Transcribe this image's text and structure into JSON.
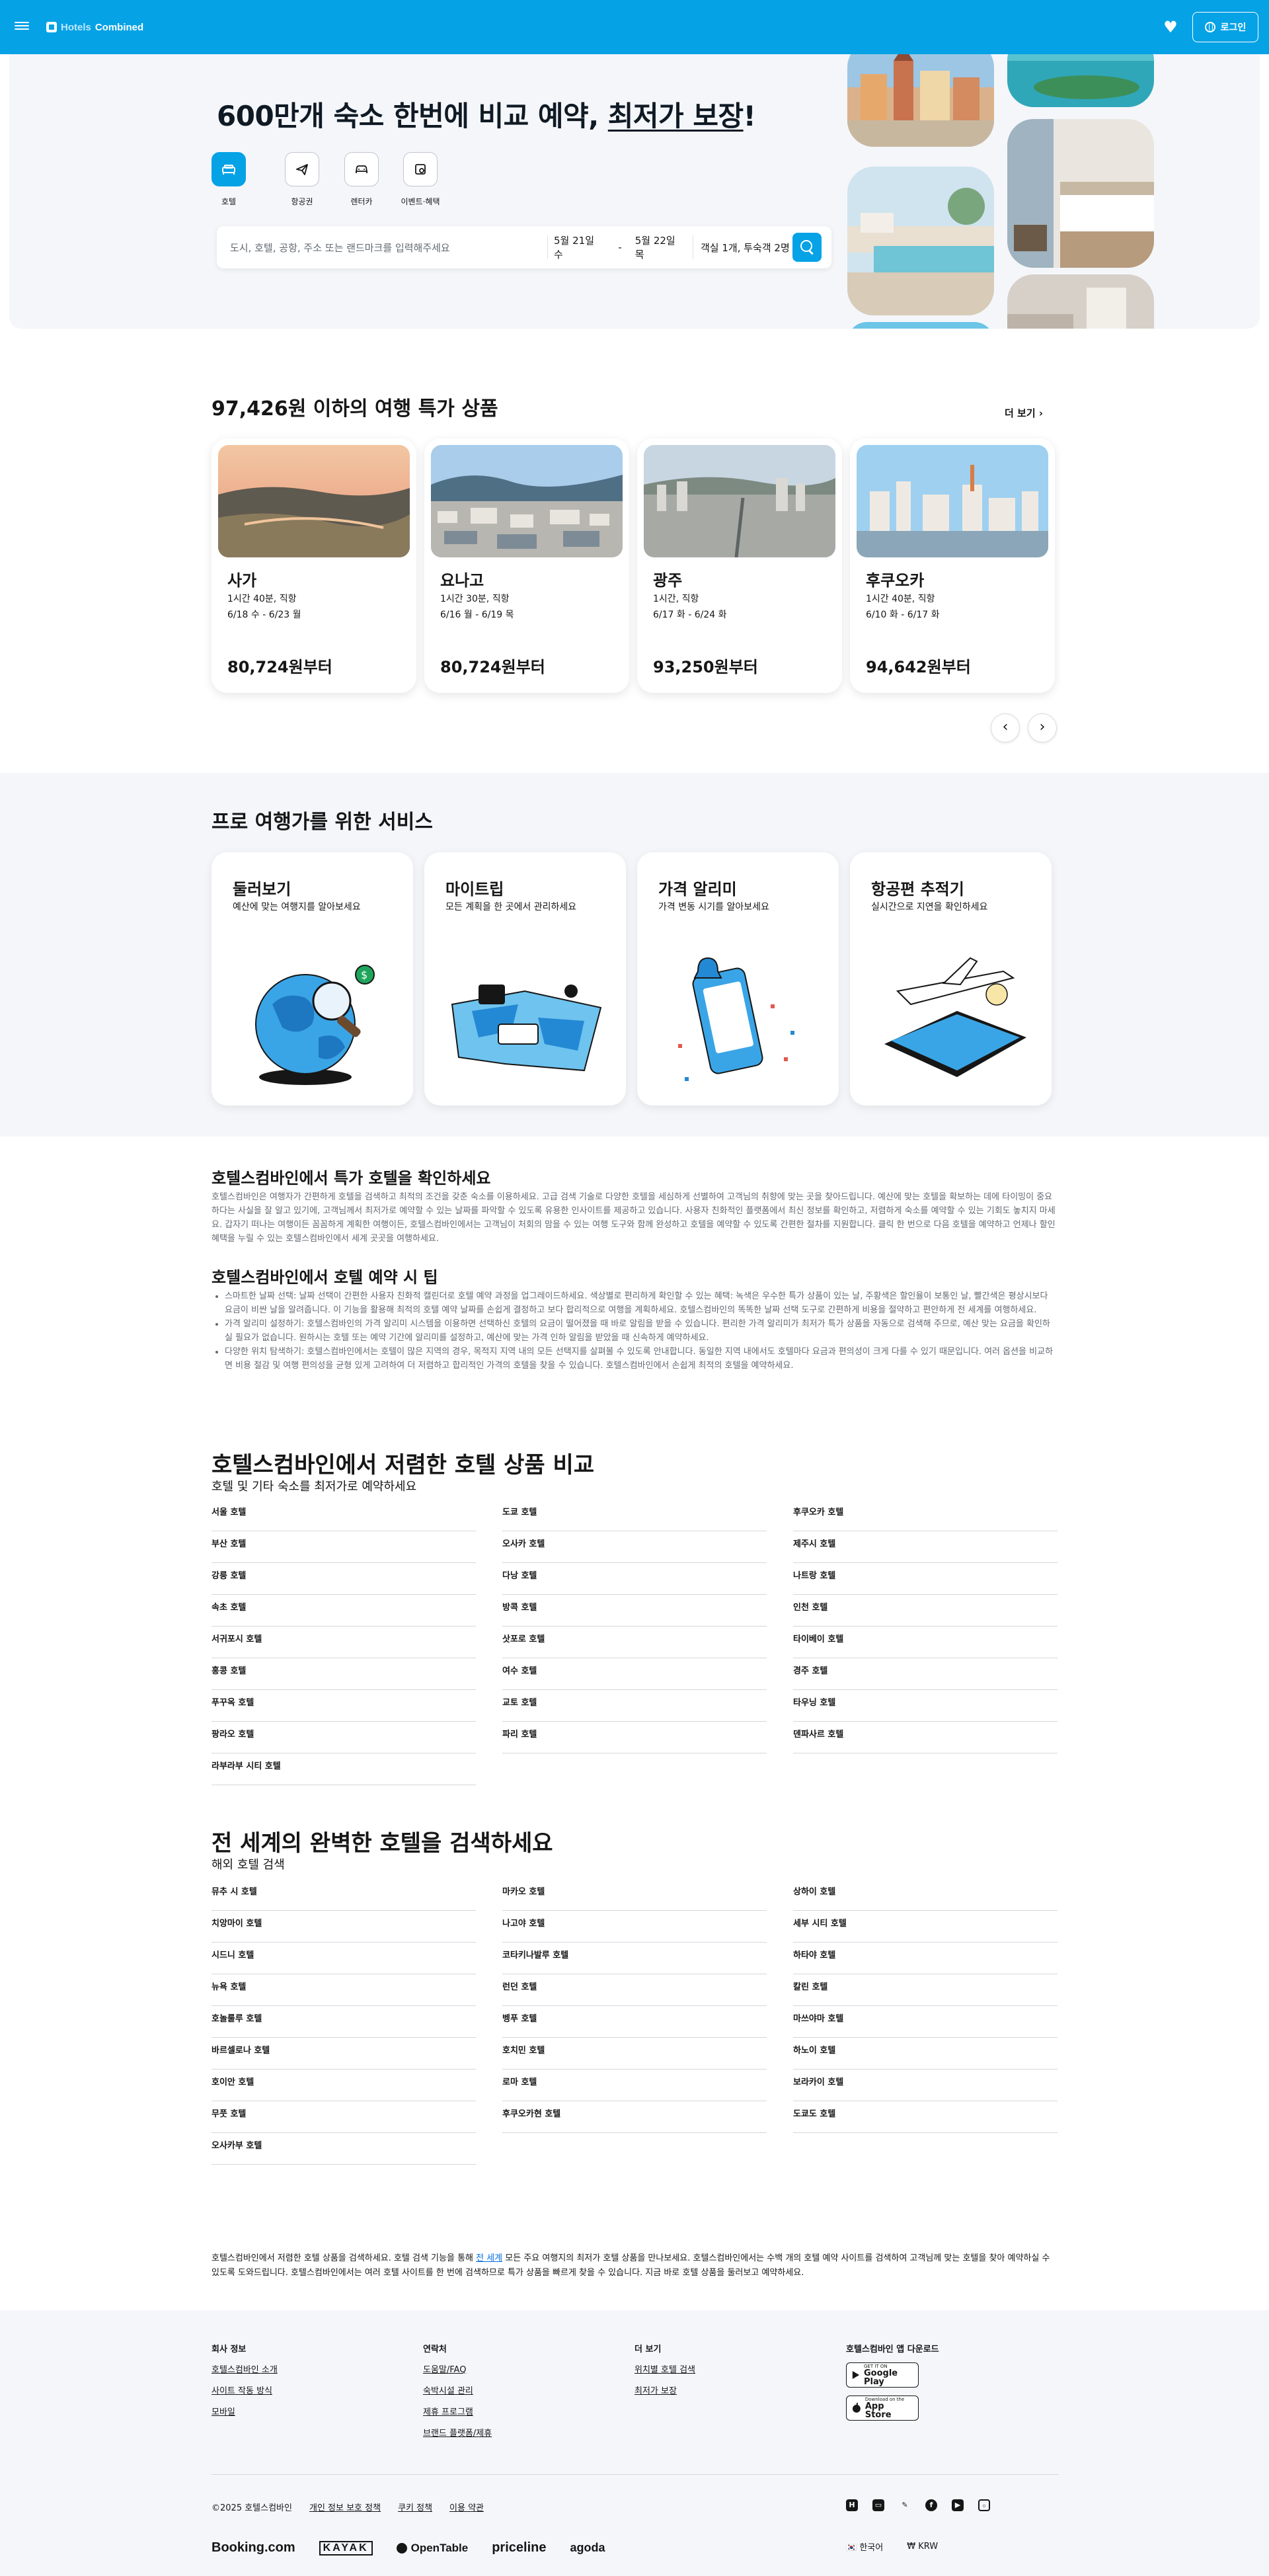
{
  "header": {
    "logo_hotels": "Hotels",
    "logo_combined": "Combined",
    "login_label": "로그인"
  },
  "hero": {
    "title_prefix": "600만개 숙소 한번에 비교 예약, ",
    "title_underlined": "최저가 보장",
    "title_suffix": "!",
    "tabs": [
      {
        "label": "호텔",
        "icon": "bed-icon",
        "active": true
      },
      {
        "label": "항공권",
        "icon": "plane-icon",
        "active": false
      },
      {
        "label": "렌터카",
        "icon": "car-icon",
        "active": false
      },
      {
        "label": "이벤트·혜택",
        "icon": "coupon-icon",
        "active": false
      }
    ],
    "search": {
      "destination_placeholder": "도시, 호텔, 공항, 주소 또는 랜드마크를 입력해주세요",
      "checkin": "5월 21일 수",
      "dash": "-",
      "checkout": "5월 22일 목",
      "guests": "객실 1개, 투숙객 2명"
    }
  },
  "deals": {
    "title": "97,426원 이하의 여행 특가 상품",
    "see_more": "더 보기",
    "cards": [
      {
        "city": "사가",
        "flight": "1시간 40분, 직항",
        "dates": "6/18 수 - 6/23 월",
        "price": "80,724원부터"
      },
      {
        "city": "요나고",
        "flight": "1시간 30분, 직항",
        "dates": "6/16 월 - 6/19 목",
        "price": "80,724원부터"
      },
      {
        "city": "광주",
        "flight": "1시간, 직항",
        "dates": "6/17 화 - 6/24 화",
        "price": "93,250원부터"
      },
      {
        "city": "후쿠오카",
        "flight": "1시간 40분, 직항",
        "dates": "6/10 화 - 6/17 화",
        "price": "94,642원부터"
      }
    ]
  },
  "services": {
    "title": "프로 여행가를 위한 서비스",
    "cards": [
      {
        "title": "둘러보기",
        "sub": "예산에 맞는 여행지를 알아보세요"
      },
      {
        "title": "마이트립",
        "sub": "모든 계획을 한 곳에서 관리하세요"
      },
      {
        "title": "가격 알리미",
        "sub": "가격 변동 시기를 알아보세요"
      },
      {
        "title": "항공편 추적기",
        "sub": "실시간으로 지연을 확인하세요"
      }
    ]
  },
  "seo": {
    "h1": "호텔스컴바인에서 특가 호텔을 확인하세요",
    "p1": "호텔스컴바인은 여행자가 간편하게 호텔을 검색하고 최적의 조건을 갖춘 숙소를 이용하세요. 고급 검색 기술로 다양한 호텔을 세심하게 선별하여 고객님의 취향에 맞는 곳을 찾아드립니다. 예산에 맞는 호텔을 확보하는 데에 타이밍이 중요하다는 사실을 잘 알고 있기에, 고객님께서 최저가로 예약할 수 있는 날짜를 파악할 수 있도록 유용한 인사이트를 제공하고 있습니다. 사용자 친화적인 플랫폼에서 최신 정보를 확인하고, 저렴하게 숙소를 예약할 수 있는 기회도 놓치지 마세요. 갑자기 떠나는 여행이든 꼼꼼하게 계획한 여행이든, 호텔스컴바인에서는 고객님이 처회의 맘을 수 있는 여행 도구와 함께 완성하고 호텔을 예약할 수 있도록 간편한 절차를 지원합니다. 클릭 한 번으로 다음 호텔을 예약하고 언제나 할인 혜택을 누릴 수 있는 호텔스컴바인에서 세계 곳곳을 여행하세요.",
    "h2": "호텔스컴바인에서 호텔 예약 시 팁",
    "tips": [
      "스마트한 날짜 선택: 날짜 선택이 간편한 사용자 친화적 캘린더로 호텔 예약 과정을 업그레이드하세요. 색상별로 편리하게 확인할 수 있는 혜택: 녹색은 우수한 특가 상품이 있는 날, 주황색은 할인율이 보통인 날, 빨간색은 평상시보다 요금이 비싼 날을 알려줍니다. 이 기능을 활용해 최적의 호텔 예약 날짜를 손쉽게 결정하고 보다 합리적으로 여행을 계획하세요. 호텔스컴바인의 똑똑한 날짜 선택 도구로 간편하게 비용을 절약하고 편안하게 전 세계를 여행하세요.",
      "가격 알리미 설정하기: 호텔스컴바인의 가격 알리미 시스템을 이용하면 선택하신 호텔의 요금이 떨어졌을 때 바로 알림을 받을 수 있습니다. 편리한 가격 알리미가 최저가 특가 상품을 자동으로 검색해 주므로, 예산 맞는 요금을 확인하실 필요가 없습니다. 원하시는 호텔 또는 예약 기간에 알리미를 설정하고, 예산에 맞는 가격 인하 알림을 받았을 때 신속하게 예약하세요.",
      "다양한 위치 탐색하기: 호텔스컴바인에서는 호텔이 많은 지역의 경우, 목적지 지역 내의 모든 선택지를 살펴볼 수 있도록 안내합니다. 동일한 지역 내에서도 호텔마다 요금과 편의성이 크게 다를 수 있기 때문입니다. 여러 옵션을 비교하면 비용 절감 및 여행 편의성을 균형 있게 고려하여 더 저렴하고 합리적인 가격의 호텔을 찾을 수 있습니다. 호텔스컴바인에서 손쉽게 최적의 호텔을 예약하세요."
    ]
  },
  "domestic": {
    "title": "호텔스컴바인에서 저렴한 호텔 상품 비교",
    "sub": "호텔 및 기타 숙소를 최저가로 예약하세요",
    "col1": [
      "서울 호텔",
      "부산 호텔",
      "강릉 호텔",
      "속초 호텔",
      "서귀포시 호텔",
      "홍콩 호텔",
      "푸꾸옥 호텔",
      "팡라오 호텔",
      "라부라부 시티 호텔"
    ],
    "col2": [
      "도쿄 호텔",
      "오사카 호텔",
      "다낭 호텔",
      "방콕 호텔",
      "삿포로 호텔",
      "여수 호텔",
      "교토 호텔",
      "파리 호텔"
    ],
    "col3": [
      "후쿠오카 호텔",
      "제주시 호텔",
      "나트랑 호텔",
      "인천 호텔",
      "타이베이 호텔",
      "경주 호텔",
      "타우닝 호텔",
      "덴파사르 호텔"
    ]
  },
  "world": {
    "title": "전 세계의 완벽한 호텔을 검색하세요",
    "sub": "해외 호텔 검색",
    "col1": [
      "뮤추 시 호텔",
      "치앙마이 호텔",
      "시드니 호텔",
      "뉴욕 호텔",
      "호놀룰루 호텔",
      "바르셀로나 호텔",
      "호이안 호텔",
      "무풋 호텔",
      "오사카부 호텔"
    ],
    "col2": [
      "마카오 호텔",
      "나고야 호텔",
      "코타키나발루 호텔",
      "런던 호텔",
      "벵푸 호텔",
      "호치민 호텔",
      "로마 호텔",
      "후쿠오카현 호텔"
    ],
    "col3": [
      "상하이 호텔",
      "세부 시티 호텔",
      "하타야 호텔",
      "칼린 호텔",
      "마쓰야마 호텔",
      "하노이 호텔",
      "보라카이 호텔",
      "도쿄도 호텔"
    ]
  },
  "footer_note": {
    "before": "호텔스컴바인에서 저렴한 호텔 상품을 검색하세요. 호텔 검색 기능을 통해 ",
    "link": "전 세계",
    "after": " 모든 주요 여행지의 최저가 호텔 상품을 만나보세요. 호텔스컴바인에서는 수백 개의 호텔 예약 사이트를 검색하여 고객님께 맞는 호텔을 찾아 예약하실 수 있도록 도와드립니다. 호텔스컴바인에서는 여러 호텔 사이트를 한 번에 검색하므로 특가 상품을 빠르게 찾을 수 있습니다. 지금 바로 호텔 상품을 둘러보고 예약하세요."
  },
  "footer": {
    "company_head": "회사 정보",
    "company_links": [
      "호텔스컴바인 소개",
      "사이트 작동 방식",
      "모바일"
    ],
    "contact_head": "연락처",
    "contact_links": [
      "도움말/FAQ",
      "숙박시설 관리",
      "제휴 프로그램",
      "브랜드 플랫폼/제휴"
    ],
    "more_head": "더 보기",
    "more_links": [
      "위치별 호텔 검색",
      "최저가 보장"
    ],
    "app_head": "호텔스컴바인 앱 다운로드",
    "google_small": "GET IT ON",
    "google_big": "Google Play",
    "apple_small": "Download on the",
    "apple_big": "App Store",
    "copyright": "©2025 호텔스컴바인",
    "legal_links": [
      "개인 정보 보호 정책",
      "쿠키 정책",
      "이용 약관"
    ],
    "brands": [
      "Booking.com",
      "KAYAK",
      "OpenTable",
      "priceline",
      "agoda"
    ],
    "country": "한국어",
    "currency": "KRW"
  },
  "colors": {
    "brand_blue": "#05a2e6",
    "text": "#161616",
    "light_bg": "#f4f6fa"
  }
}
